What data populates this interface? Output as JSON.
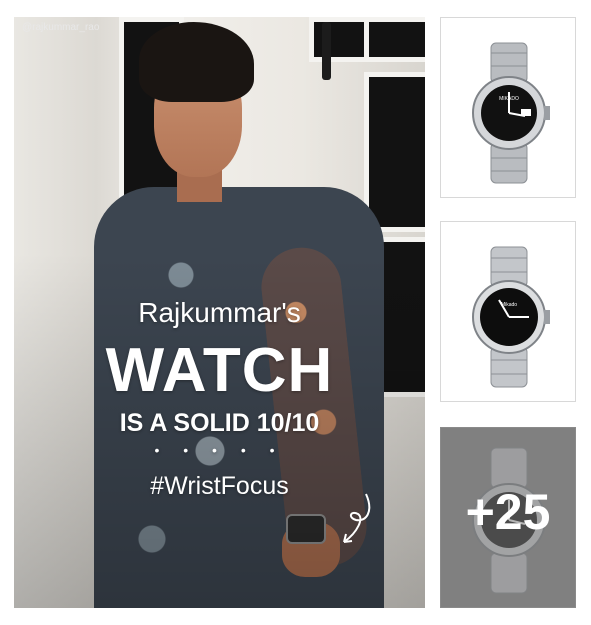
{
  "hero": {
    "handle": "@rajkummar_rao",
    "line1": "Rajkummar's",
    "line2": "WATCH",
    "line3": "IS A SOLID 10/10",
    "dots": "• • • • •",
    "hashtag": "#WristFocus"
  },
  "thumbnails": [
    {
      "brand": "MIKADO",
      "dial": "black-day-date"
    },
    {
      "brand": "Mikado",
      "dial": "black-plain"
    },
    {
      "brand": "",
      "dial": "black-silver",
      "more_count": "+25"
    }
  ],
  "colors": {
    "overlay_text": "#ffffff",
    "more_overlay": "#8a8a8a",
    "border": "#d8d8d8"
  }
}
